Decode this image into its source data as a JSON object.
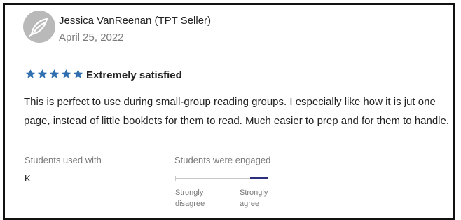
{
  "reviewer": {
    "name": "Jessica VanReenan (TPT Seller)",
    "date": "April 25, 2022",
    "avatar_icon": "leaf-avatar-icon"
  },
  "rating": {
    "stars": 5,
    "max_stars": 5,
    "label": "Extremely satisfied",
    "star_color": "#2f6fb0"
  },
  "review_text": "This is perfect to use during small-group reading groups.  I especially like how it is jut one page, instead of little booklets for them to read.  Much easier to prep and for them to handle.",
  "details": {
    "students_used_with_label": "Students used with",
    "students_used_with_value": "K",
    "engaged_label": "Students were engaged",
    "engaged_level": 1.0,
    "scale_left_line1": "Strongly",
    "scale_left_line2": "disagree",
    "scale_right_line1": "Strongly",
    "scale_right_line2": "agree",
    "scale_color": "#2b2f7c"
  }
}
